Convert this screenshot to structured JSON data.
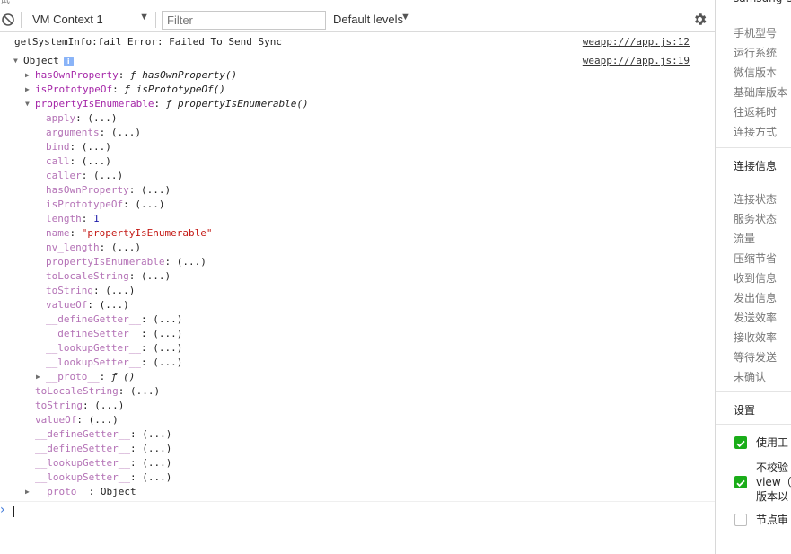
{
  "top_clip": [
    "试",
    "...",
    "...",
    "...",
    "...",
    "..."
  ],
  "toolbar": {
    "context": "VM Context 1",
    "filter_placeholder": "Filter",
    "levels": "Default levels"
  },
  "messages": {
    "error_text": "getSystemInfo:fail Error: Failed To Send Sync",
    "error_source": "weapp:///app.js:12",
    "object_label": "Object",
    "object_badge": "i",
    "object_source": "weapp:///app.js:19"
  },
  "tree": {
    "hasOwnProperty": {
      "key": "hasOwnProperty",
      "val": "ƒ hasOwnProperty()"
    },
    "isPrototypeOf": {
      "key": "isPrototypeOf",
      "val": "ƒ isPrototypeOf()"
    },
    "propertyIsEnumerable": {
      "key": "propertyIsEnumerable",
      "val": "ƒ propertyIsEnumerable()"
    },
    "children": [
      {
        "key": "apply",
        "val": "(...)"
      },
      {
        "key": "arguments",
        "val": "(...)"
      },
      {
        "key": "bind",
        "val": "(...)"
      },
      {
        "key": "call",
        "val": "(...)"
      },
      {
        "key": "caller",
        "val": "(...)"
      },
      {
        "key": "hasOwnProperty",
        "val": "(...)"
      },
      {
        "key": "isPrototypeOf",
        "val": "(...)"
      },
      {
        "key": "length",
        "val": "1"
      },
      {
        "key": "name",
        "val": "\"propertyIsEnumerable\""
      },
      {
        "key": "nv_length",
        "val": "(...)"
      },
      {
        "key": "propertyIsEnumerable",
        "val": "(...)"
      },
      {
        "key": "toLocaleString",
        "val": "(...)"
      },
      {
        "key": "toString",
        "val": "(...)"
      },
      {
        "key": "valueOf",
        "val": "(...)"
      },
      {
        "key": "__defineGetter__",
        "val": "(...)"
      },
      {
        "key": "__defineSetter__",
        "val": "(...)"
      },
      {
        "key": "__lookupGetter__",
        "val": "(...)"
      },
      {
        "key": "__lookupSetter__",
        "val": "(...)"
      }
    ],
    "inner_proto": {
      "key": "__proto__",
      "val": "ƒ ()"
    },
    "siblings": [
      {
        "key": "toLocaleString",
        "val": "(...)"
      },
      {
        "key": "toString",
        "val": "(...)"
      },
      {
        "key": "valueOf",
        "val": "(...)"
      },
      {
        "key": "__defineGetter__",
        "val": "(...)"
      },
      {
        "key": "__defineSetter__",
        "val": "(...)"
      },
      {
        "key": "__lookupGetter__",
        "val": "(...)"
      },
      {
        "key": "__lookupSetter__",
        "val": "(...)"
      }
    ],
    "outer_proto": {
      "key": "__proto__",
      "val": "Object"
    }
  },
  "prompt": {
    "arrow": "›"
  },
  "side": {
    "device": "samsung-S",
    "group1": [
      "手机型号",
      "运行系统",
      "微信版本",
      "基础库版本",
      "往返耗时",
      "连接方式"
    ],
    "head_conn": "连接信息",
    "group2": [
      "连接状态",
      "服务状态",
      "流量",
      "压缩节省",
      "收到信息",
      "发出信息",
      "发送效率",
      "接收效率",
      "等待发送",
      "未确认"
    ],
    "head_settings": "设置",
    "settings": [
      {
        "label": "使用工",
        "checked": true
      },
      {
        "label": "不校验\nview（\n版本以",
        "checked": true
      },
      {
        "label": "节点审",
        "checked": false
      }
    ]
  },
  "colors": {
    "key": "#a526a8",
    "string": "#c41a16",
    "number": "#1c1aa8",
    "check": "#1aad19",
    "prompt": "#3d77d9"
  }
}
